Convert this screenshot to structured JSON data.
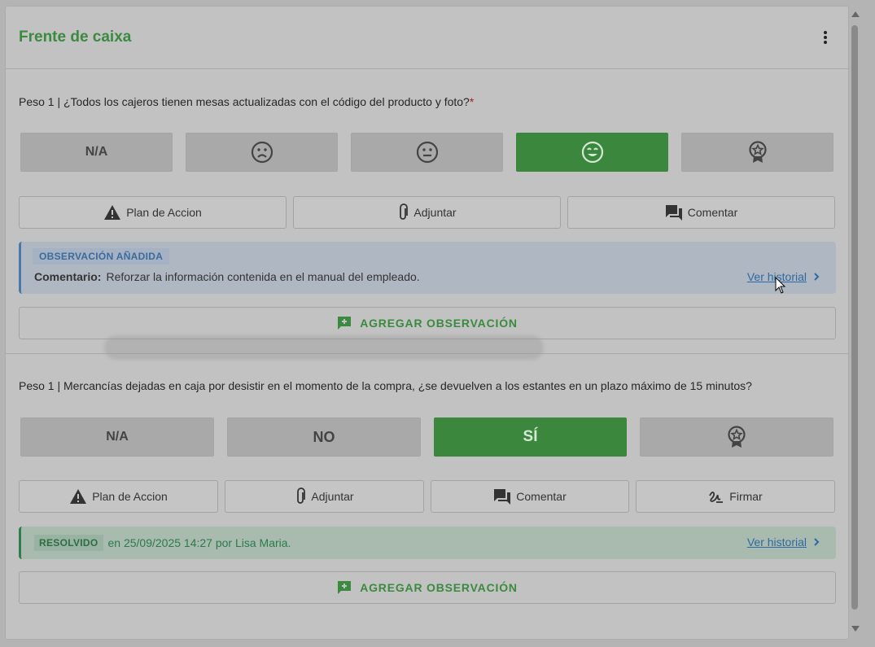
{
  "card": {
    "title": "Frente de caixa"
  },
  "section1": {
    "question": "Peso 1 | ¿Todos los cajeros tienen mesas actualizadas con el código del producto y foto?",
    "required_mark": "*",
    "rating": {
      "na_label": "N/A",
      "selected": "happy"
    },
    "actions": {
      "plan": "Plan de Accion",
      "attach": "Adjuntar",
      "comment": "Comentar"
    },
    "observation": {
      "tag": "OBSERVACIÓN AÑADIDA",
      "label": "Comentario:",
      "text": "Reforzar la información contenida en el manual del empleado.",
      "history_link": "Ver historial"
    },
    "add_obs": "AGREGAR OBSERVACIÓN"
  },
  "section2": {
    "question": "Peso 1 | Mercancías dejadas en caja por desistir en el momento de la compra, ¿se devuelven a los estantes en un plazo máximo de 15 minutos?",
    "rating": {
      "na_label": "N/A",
      "no_label": "NO",
      "yes_label": "SÍ",
      "selected": "SÍ"
    },
    "actions": {
      "plan": "Plan de Accion",
      "attach": "Adjuntar",
      "comment": "Comentar",
      "sign": "Firmar"
    },
    "resolved": {
      "tag": "RESOLVIDO",
      "text": "en 25/09/2025 14:27 por Lisa Maria.",
      "history_link": "Ver historial"
    },
    "add_obs": "AGREGAR OBSERVACIÓN"
  },
  "colors": {
    "accent_green": "#3a8a3f",
    "selected_green": "#3b873d",
    "link_blue": "#2d6aa3"
  }
}
